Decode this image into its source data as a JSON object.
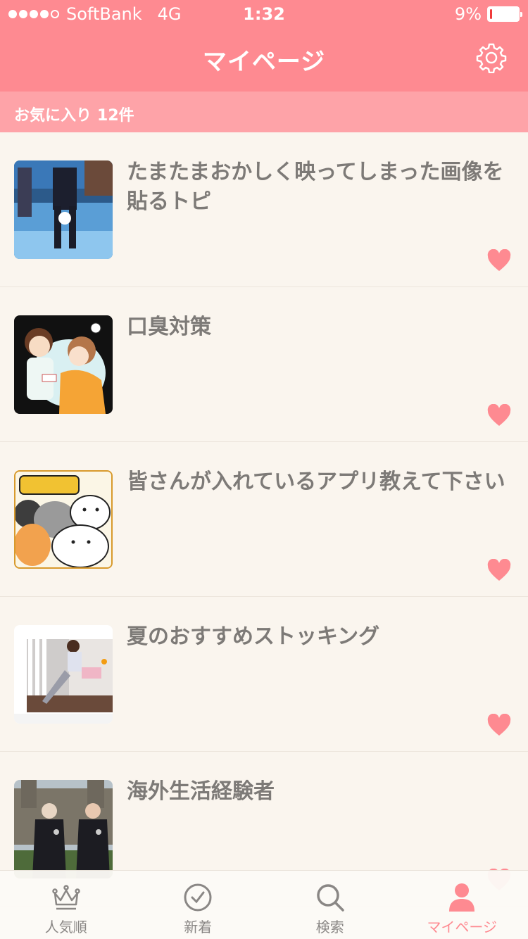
{
  "status_bar": {
    "carrier": "SoftBank",
    "network": "4G",
    "time": "1:32",
    "battery_percent": "9%",
    "battery_level": 0.09,
    "signal_bars_filled": 4,
    "signal_bars_total": 5
  },
  "header": {
    "title": "マイページ",
    "settings_icon": "gear-icon"
  },
  "favorites": {
    "label": "お気に入り",
    "count": "12件"
  },
  "items": [
    {
      "title": "たまたまおかしく映ってしまった画像を貼るトピ",
      "favorited": true
    },
    {
      "title": "口臭対策",
      "favorited": true
    },
    {
      "title": "皆さんが入れているアプリ教えて下さい",
      "favorited": true
    },
    {
      "title": "夏のおすすめストッキング",
      "favorited": true
    },
    {
      "title": "海外生活経験者",
      "favorited": true
    }
  ],
  "tabs": [
    {
      "label": "人気順",
      "icon": "crown-icon",
      "active": false
    },
    {
      "label": "新着",
      "icon": "clock-icon",
      "active": false
    },
    {
      "label": "検索",
      "icon": "search-icon",
      "active": false
    },
    {
      "label": "マイページ",
      "icon": "person-icon",
      "active": true
    }
  ],
  "colors": {
    "accent": "#fe8a91",
    "subheader": "#fea3a8",
    "background": "#faf5ee",
    "title_text": "#7d7a77",
    "tab_inactive": "#8a8785"
  }
}
